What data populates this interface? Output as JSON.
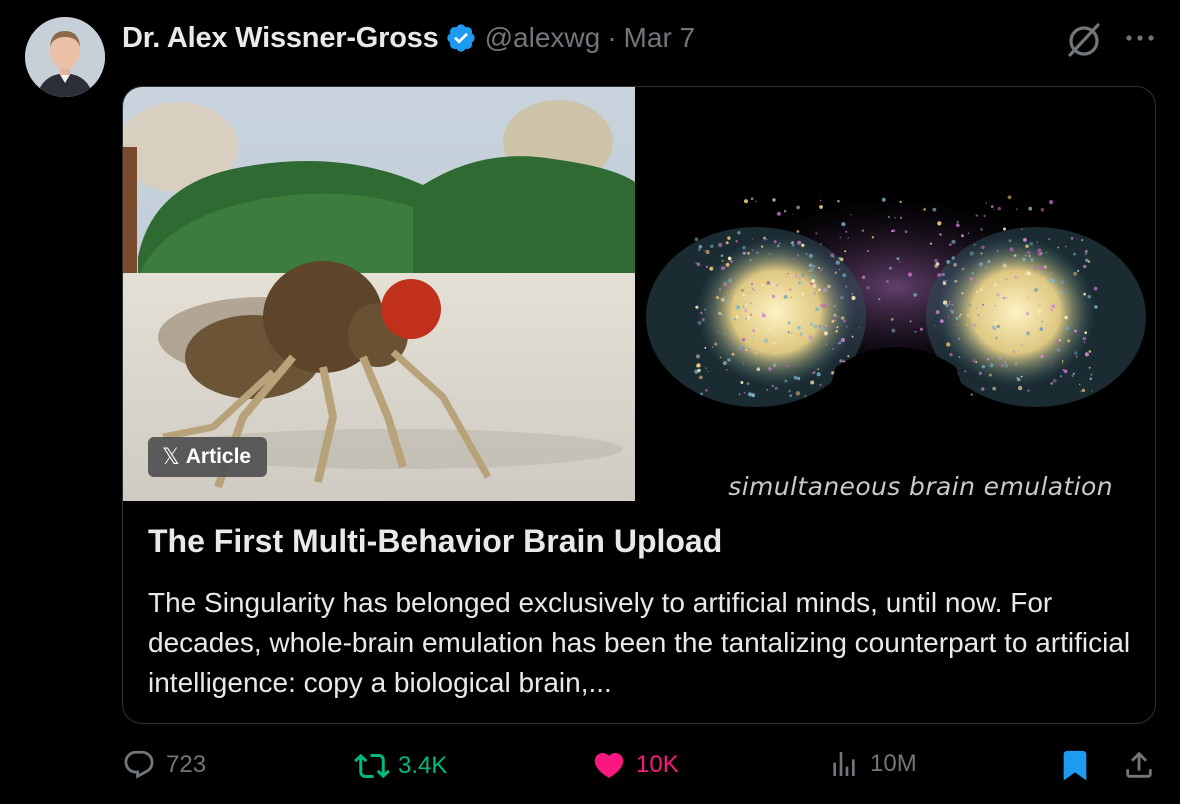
{
  "author": {
    "name": "Dr. Alex Wissner-Gross",
    "handle": "@alexwg",
    "separator": "·",
    "date": "Mar 7"
  },
  "card": {
    "badge_label": "Article",
    "badge_icon": "x-logo-icon",
    "image_caption": "simultaneous brain emulation",
    "title": "The First Multi-Behavior Brain Upload",
    "description": "The Singularity has belonged exclusively to artificial minds, until now. For decades, whole-brain emulation has been the tantalizing counterpart to artificial intelligence: copy a biological brain,..."
  },
  "actions": {
    "replies": "723",
    "reposts": "3.4K",
    "likes": "10K",
    "views": "10M"
  },
  "colors": {
    "background": "#000000",
    "text": "#e7e9ea",
    "muted": "#71767b",
    "verified": "#1d9bf0",
    "repost": "#00ba7c",
    "like": "#f91880",
    "bookmark": "#1d9bf0"
  }
}
